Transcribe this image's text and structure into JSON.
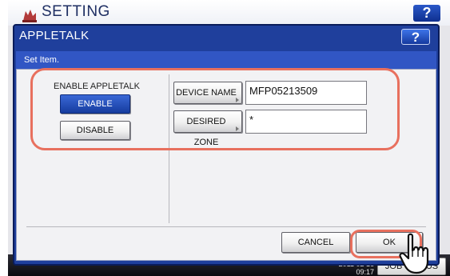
{
  "background": {
    "title": "SETTING",
    "help_label": "?",
    "clock_lines": [
      "2011 02 16",
      "09:17"
    ],
    "job_status_label": "JOB STATUS"
  },
  "dialog": {
    "title": "APPLETALK",
    "help_label": "?",
    "subtitle": "Set Item.",
    "enable_section": {
      "label": "ENABLE APPLETALK",
      "enable_label": "ENABLE",
      "disable_label": "DISABLE",
      "selected": "ENABLE"
    },
    "fields": {
      "device_name": {
        "label": "DEVICE NAME",
        "value": "MFP05213509"
      },
      "desired_zone": {
        "label": "DESIRED ZONE",
        "value": "*"
      }
    },
    "cancel_label": "CANCEL",
    "ok_label": "OK"
  },
  "colors": {
    "dialog_blue": "#1f3f9c",
    "subheader_blue": "#3156c4",
    "selected_button": "#163c9f",
    "highlight": "#e8705e"
  },
  "icons": [
    "gear-icon",
    "help-icon",
    "triangle-icon",
    "pointing-hand-icon"
  ]
}
